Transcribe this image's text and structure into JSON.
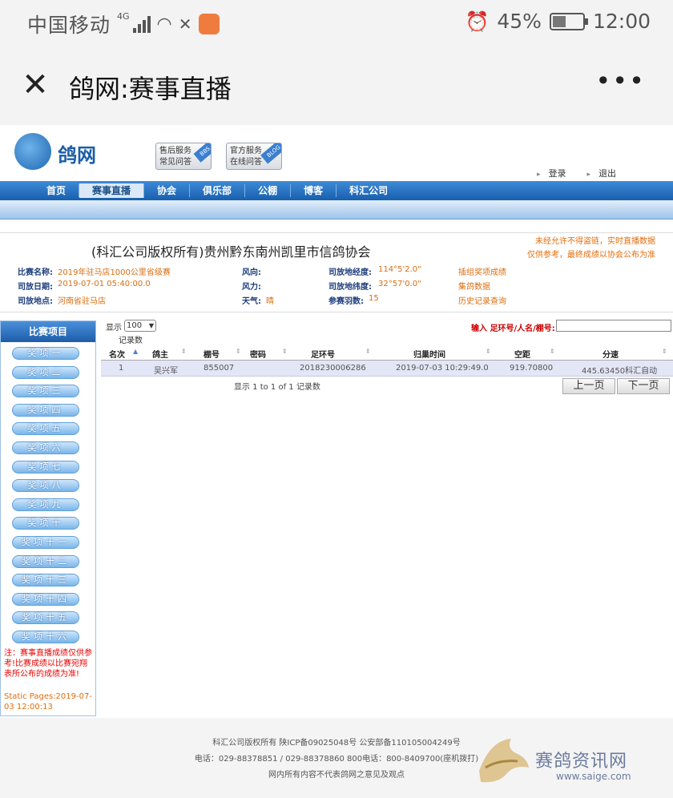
{
  "status_bar": {
    "carrier": "中国移动",
    "network": "4G",
    "battery": "45%",
    "battery_level": 0.45,
    "time": "12:00"
  },
  "title_bar": {
    "title": "鸽网:赛事直播",
    "close_symbol": "✕",
    "more_symbol": "•••"
  },
  "header": {
    "logo_text": "鸽网",
    "btn_service": {
      "line1": "售后服务",
      "line2": "常见问答",
      "tag": "BBS"
    },
    "btn_official": {
      "line1": "官方服务",
      "line2": "在线问答",
      "tag": "BLOG"
    },
    "login": "登录",
    "logout": "退出"
  },
  "nav": [
    "首页",
    "赛事直播",
    "协会",
    "俱乐部",
    "公棚",
    "博客",
    "科汇公司"
  ],
  "info": {
    "title": "(科汇公司版权所有)贵州黔东南州凯里市信鸽协会",
    "warning_line1": "未经允许不得盗链，实时直播数据",
    "warning_line2": "仅供参考，最终成绩以协会公布为准",
    "race_name_label": "比赛名称:",
    "race_name": "2019年驻马店1000公里省级赛",
    "release_date_label": "司放日期:",
    "release_date": "2019-07-01 05:40:00.0",
    "release_place_label": "司放地点:",
    "release_place": "河南省驻马店",
    "wind_dir_label": "风向:",
    "wind_dir": "",
    "wind_power_label": "风力:",
    "wind_power": "",
    "weather_label": "天气:",
    "weather": "晴",
    "lng_label": "司放地经度:",
    "lng": "114°5'2.0\"",
    "lat_label": "司放地纬度:",
    "lat": "32°57'0.0\"",
    "count_label": "参赛羽数:",
    "count": "15",
    "link1": "插组奖项成绩",
    "link2": "集鸽数据",
    "link3": "历史记录查询"
  },
  "sidebar": {
    "title": "比赛项目",
    "awards": [
      "奖项一",
      "奖项二",
      "奖项三",
      "奖项四",
      "奖项五",
      "奖项六",
      "奖项七",
      "奖项八",
      "奖项九",
      "奖项十",
      "奖项十一",
      "奖项十二",
      "奖项十三",
      "奖项十四",
      "奖项十五",
      "奖项十六"
    ],
    "note": "注：赛事直播成绩仅供参考!比赛成绩以比赛宛翔表所公布的成绩为准!",
    "static_pages": "Static Pages:2019-07-03 12:00:13"
  },
  "table": {
    "show_label": "显示",
    "show_value": "100",
    "records_label": "记录数",
    "search_label": "输入 足环号/人名/棚号:",
    "search_value": "",
    "columns": [
      "名次",
      "鸽主",
      "棚号",
      "密码",
      "足环号",
      "归巢时间",
      "空距",
      "分速"
    ],
    "rows": [
      [
        "1",
        "吴兴军",
        "855007",
        "",
        "2018230006286",
        "2019-07-03 10:29:49.0",
        "919.70800",
        "445.63450科汇自动"
      ]
    ],
    "page_info": "显示 1 to 1 of 1 记录数",
    "prev": "上一页",
    "next": "下一页"
  },
  "footer": {
    "line1": "科汇公司版权所有 陕ICP备09025048号 公安部备110105004249号",
    "line2": "电话：029-88378851 / 029-88378860  800电话：800-8409700(座机拨打)",
    "line3": "网内所有内容不代表鸽网之意见及观点",
    "watermark": "赛鸽资讯网",
    "watermark_url": "www.saige.com"
  }
}
